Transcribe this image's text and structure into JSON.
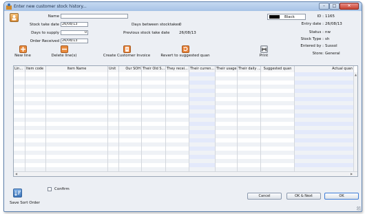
{
  "window": {
    "title": "Enter new customer stock history...",
    "min_glyph": "–",
    "max_glyph": "□",
    "close_glyph": "✕"
  },
  "form": {
    "name": {
      "label": "Name",
      "value": ""
    },
    "stock_take_date": {
      "label": "Stock take date",
      "value": "26/08/13"
    },
    "days_to_supply": {
      "label": "Days to supply",
      "value": "0"
    },
    "order_received": {
      "label": "Order Received",
      "value": "26/08/13"
    },
    "days_between": {
      "label": "Days between stocktakes",
      "value": "0"
    },
    "previous_date": {
      "label": "Previous stock take date",
      "value": "26/08/13"
    }
  },
  "status": {
    "color_label": "Black",
    "id": {
      "label": "ID :",
      "value": "1165"
    },
    "entry_date": {
      "label": "Entry date :",
      "value": "26/08/13"
    },
    "status": {
      "label": "Status :",
      "value": "nw"
    },
    "stock_type": {
      "label": "Stock Type :",
      "value": "sh"
    },
    "entered_by": {
      "label": "Entered by :",
      "value": "Sussol"
    },
    "store": {
      "label": "Store:",
      "value": "General"
    }
  },
  "toolbar": {
    "new_line": "New line",
    "delete_lines": "Delete line(s)",
    "create_invoice": "Create Customer Invoice",
    "revert": "Revert to suggested quan",
    "print": "Print"
  },
  "table": {
    "columns": [
      "Lin...",
      "Item code",
      "Item Name",
      "Unit",
      "Our SOH",
      "Their Old S...",
      "They recei...",
      "Their curren...",
      "Their usage",
      "Their daily ...",
      "Suggested quan",
      "Actual quan"
    ]
  },
  "footer": {
    "confirm": "Confirm",
    "save_sort": "Save Sort Order",
    "cancel": "Cancel",
    "ok_next": "OK & Next",
    "ok": "OK"
  },
  "colors": {
    "accent": "#5e81ae",
    "swatch": "#000000",
    "current_col": "#e3e9fb"
  },
  "icons": {
    "app": "app-icon",
    "new_line": "plus-icon",
    "delete": "minus-icon",
    "invoice": "invoice-icon",
    "revert": "revert-icon",
    "print": "printer-icon",
    "user": "user-icon",
    "save_sort": "save-sort-icon"
  }
}
